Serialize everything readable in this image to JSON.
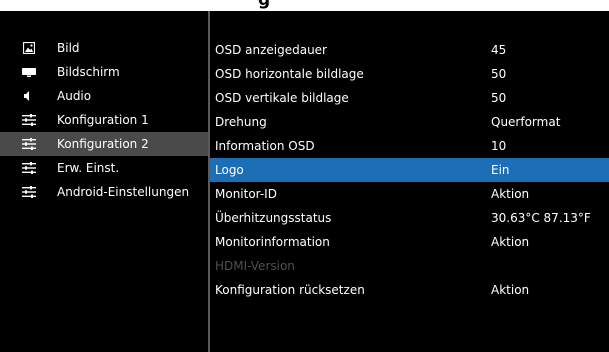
{
  "menu": {
    "sidebar": [
      {
        "label": "Bild",
        "icon": "picture-icon",
        "active": false
      },
      {
        "label": "Bildschirm",
        "icon": "display-icon",
        "active": false
      },
      {
        "label": "Audio",
        "icon": "speaker-icon",
        "active": false
      },
      {
        "label": "Konfiguration 1",
        "icon": "sliders-icon",
        "active": false
      },
      {
        "label": "Konfiguration 2",
        "icon": "sliders-icon",
        "active": true
      },
      {
        "label": "Erw. Einst.",
        "icon": "sliders-icon",
        "active": false
      },
      {
        "label": "Android-Einstellungen",
        "icon": "sliders-icon",
        "active": false
      }
    ],
    "settings": [
      {
        "label": "OSD anzeigedauer",
        "value": "45"
      },
      {
        "label": "OSD horizontale bildlage",
        "value": "50"
      },
      {
        "label": "OSD vertikale bildlage",
        "value": "50"
      },
      {
        "label": "Drehung",
        "value": "Querformat"
      },
      {
        "label": "Information OSD",
        "value": "10"
      },
      {
        "label": "Logo",
        "value": "Ein",
        "highlighted": true
      },
      {
        "label": "Monitor-ID",
        "value": "Aktion"
      },
      {
        "label": "Überhitzungsstatus",
        "value": "30.63°C 87.13°F"
      },
      {
        "label": "Monitorinformation",
        "value": "Aktion"
      },
      {
        "label": "HDMI-Version",
        "value": "",
        "disabled": true
      },
      {
        "label": "Konfiguration rücksetzen",
        "value": "Aktion"
      }
    ]
  },
  "colors": {
    "background": "#000000",
    "highlight": "#1d6fb5",
    "active_sidebar": "#4a4a4a",
    "disabled_text": "#4f4f4f"
  }
}
